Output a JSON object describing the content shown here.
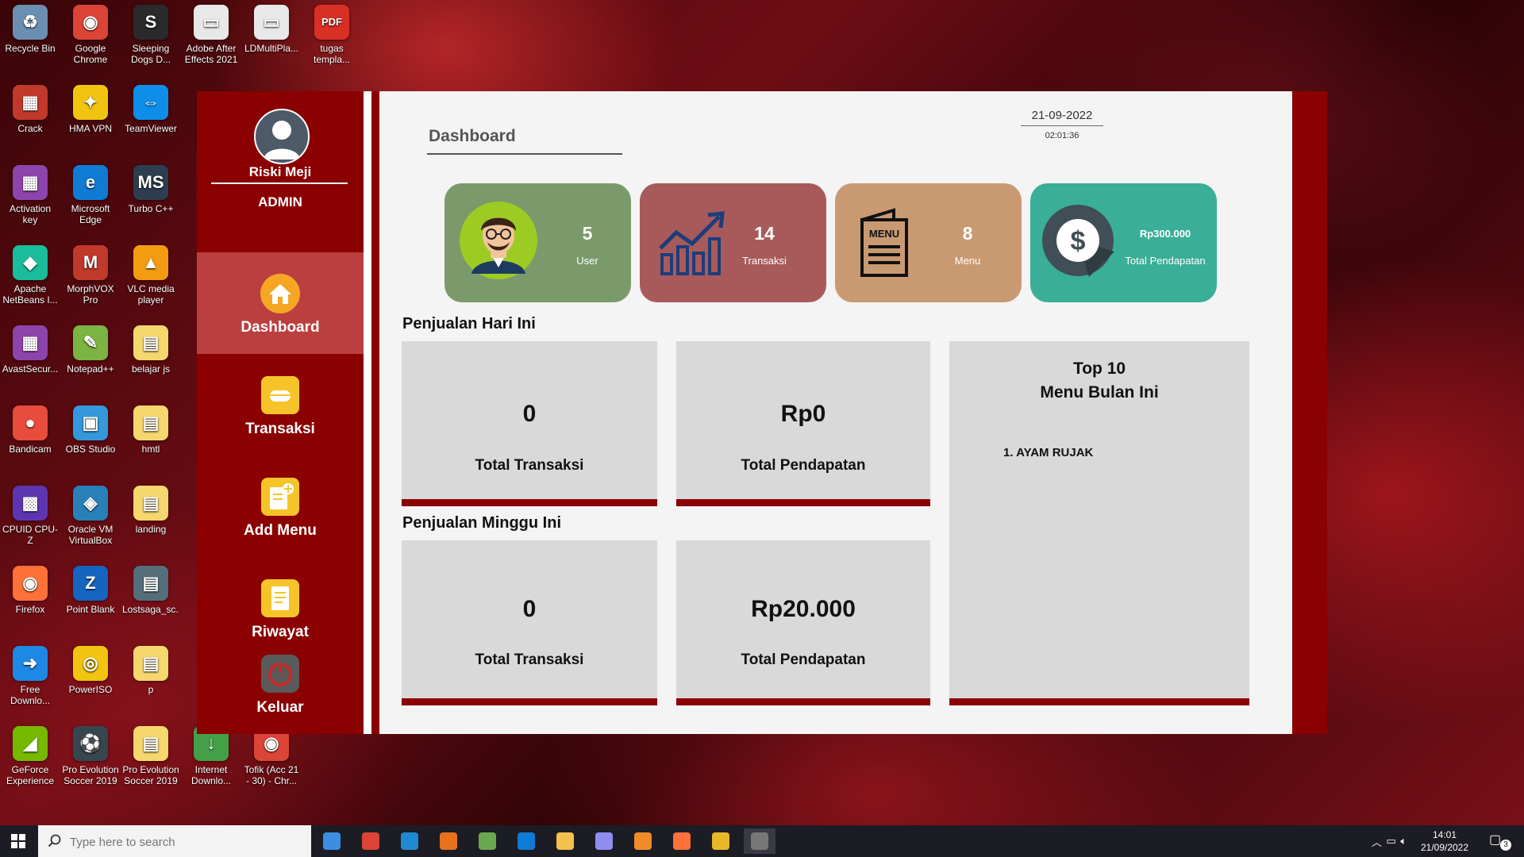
{
  "desktop": {
    "icons": [
      {
        "label": "Recycle Bin",
        "color": "#6b8fb0",
        "glyph": "♻"
      },
      {
        "label": "Google Chrome",
        "color": "#db4437",
        "glyph": "◉"
      },
      {
        "label": "Sleeping Dogs D...",
        "color": "#2a2a2a",
        "glyph": "S"
      },
      {
        "label": "Adobe After Effects 2021",
        "color": "#e8e8e8",
        "glyph": "▭"
      },
      {
        "label": "LDMultiPla...",
        "color": "#e8e8e8",
        "glyph": "▭"
      },
      {
        "label": "tugas templa...",
        "color": "#d93025",
        "glyph": "PDF"
      },
      {
        "label": "Crack",
        "color": "#c0392b",
        "glyph": "▦"
      },
      {
        "label": "HMA VPN",
        "color": "#f1c40f",
        "glyph": "✦"
      },
      {
        "label": "TeamViewer",
        "color": "#0e8ee9",
        "glyph": "⇔"
      },
      {
        "label": "Activation key",
        "color": "#8e44ad",
        "glyph": "▦"
      },
      {
        "label": "Microsoft Edge",
        "color": "#0f7bd4",
        "glyph": "e"
      },
      {
        "label": "Turbo C++",
        "color": "#2c3e50",
        "glyph": "MS"
      },
      {
        "label": "Apache NetBeans I...",
        "color": "#1abc9c",
        "glyph": "◆"
      },
      {
        "label": "MorphVOX Pro",
        "color": "#c0392b",
        "glyph": "M"
      },
      {
        "label": "VLC media player",
        "color": "#f39c12",
        "glyph": "▲"
      },
      {
        "label": "AvastSecur...",
        "color": "#8e44ad",
        "glyph": "▦"
      },
      {
        "label": "Notepad++",
        "color": "#7cb342",
        "glyph": "✎"
      },
      {
        "label": "belajar js",
        "color": "#f5d76e",
        "glyph": "▤"
      },
      {
        "label": "Bandicam",
        "color": "#e74c3c",
        "glyph": "●"
      },
      {
        "label": "OBS Studio",
        "color": "#3498db",
        "glyph": "▣"
      },
      {
        "label": "hmtl",
        "color": "#f5d76e",
        "glyph": "▤"
      },
      {
        "label": "CPUID CPU-Z",
        "color": "#5e35b1",
        "glyph": "▩"
      },
      {
        "label": "Oracle VM VirtualBox",
        "color": "#2980b9",
        "glyph": "◈"
      },
      {
        "label": "landing",
        "color": "#f5d76e",
        "glyph": "▤"
      },
      {
        "label": "Firefox",
        "color": "#ff7139",
        "glyph": "◉"
      },
      {
        "label": "Point Blank",
        "color": "#1565c0",
        "glyph": "Z"
      },
      {
        "label": "Lostsaga_sc...",
        "color": "#546e7a",
        "glyph": "▤"
      },
      {
        "label": "Free Downlo...",
        "color": "#1e88e5",
        "glyph": "➜"
      },
      {
        "label": "PowerISO",
        "color": "#f1c40f",
        "glyph": "◎"
      },
      {
        "label": "p",
        "color": "#f5d76e",
        "glyph": "▤"
      },
      {
        "label": "GeForce Experience",
        "color": "#76b900",
        "glyph": "◢"
      },
      {
        "label": "Pro Evolution Soccer 2019",
        "color": "#37474f",
        "glyph": "⚽"
      },
      {
        "label": "Pro Evolution Soccer 2019",
        "color": "#f5d76e",
        "glyph": "▤"
      },
      {
        "label": "Internet Downlo...",
        "color": "#43a047",
        "glyph": "↓"
      },
      {
        "label": "Tofik (Acc 21 - 30) - Chr...",
        "color": "#db4437",
        "glyph": "◉"
      }
    ]
  },
  "app": {
    "sidebar": {
      "user_name": "Riski Meji",
      "role": "ADMIN",
      "nav": [
        {
          "label": "Dashboard",
          "icon": "home-icon"
        },
        {
          "label": "Transaksi",
          "icon": "transaction-icon"
        },
        {
          "label": "Add Menu",
          "icon": "add-menu-icon"
        },
        {
          "label": "Riwayat",
          "icon": "history-icon"
        },
        {
          "label": "Keluar",
          "icon": "power-icon"
        }
      ]
    },
    "header": {
      "title": "Dashboard",
      "date": "21-09-2022",
      "time": "02:01:36"
    },
    "cards": [
      {
        "value": "5",
        "caption": "User",
        "color": "#7a9a6b",
        "icon": "user-avatar-icon"
      },
      {
        "value": "14",
        "caption": "Transaksi",
        "color": "#a85a5a",
        "icon": "growth-chart-icon"
      },
      {
        "value": "8",
        "caption": "Menu",
        "color": "#c99a72",
        "icon": "menu-book-icon"
      },
      {
        "value": "Rp300.000",
        "caption": "Total Pendapatan",
        "color": "#3aae97",
        "icon": "dollar-icon"
      }
    ],
    "today": {
      "title": "Penjualan Hari Ini",
      "transaksi_value": "0",
      "transaksi_label": "Total Transaksi",
      "pendapatan_value": "Rp0",
      "pendapatan_label": "Total Pendapatan"
    },
    "week": {
      "title": "Penjualan Minggu Ini",
      "transaksi_value": "0",
      "transaksi_label": "Total Transaksi",
      "pendapatan_value": "Rp20.000",
      "pendapatan_label": "Total Pendapatan"
    },
    "top10": {
      "title_line1": "Top 10",
      "title_line2": "Menu Bulan Ini",
      "items": [
        "1. AYAM RUJAK"
      ]
    }
  },
  "taskbar": {
    "search_placeholder": "Type here to search",
    "apps": [
      {
        "name": "mail-icon",
        "color": "#3b8ee0"
      },
      {
        "name": "chrome-icon",
        "color": "#db4437"
      },
      {
        "name": "vscode-icon",
        "color": "#1f8ad2"
      },
      {
        "name": "chrome-profile-icon",
        "color": "#e8711c"
      },
      {
        "name": "spreadsheet-icon",
        "color": "#6aa84f"
      },
      {
        "name": "edge-icon",
        "color": "#0f7bd4"
      },
      {
        "name": "file-explorer-icon",
        "color": "#f2c14e"
      },
      {
        "name": "loop-icon",
        "color": "#8e8ef0"
      },
      {
        "name": "sublime-icon",
        "color": "#f08c28"
      },
      {
        "name": "firefox-icon",
        "color": "#ff7139"
      },
      {
        "name": "git-icon",
        "color": "#e8b82b"
      },
      {
        "name": "java-app-icon",
        "color": "#777777"
      }
    ],
    "clock_time": "14:01",
    "clock_date": "21/09/2022",
    "notification_count": "3"
  }
}
